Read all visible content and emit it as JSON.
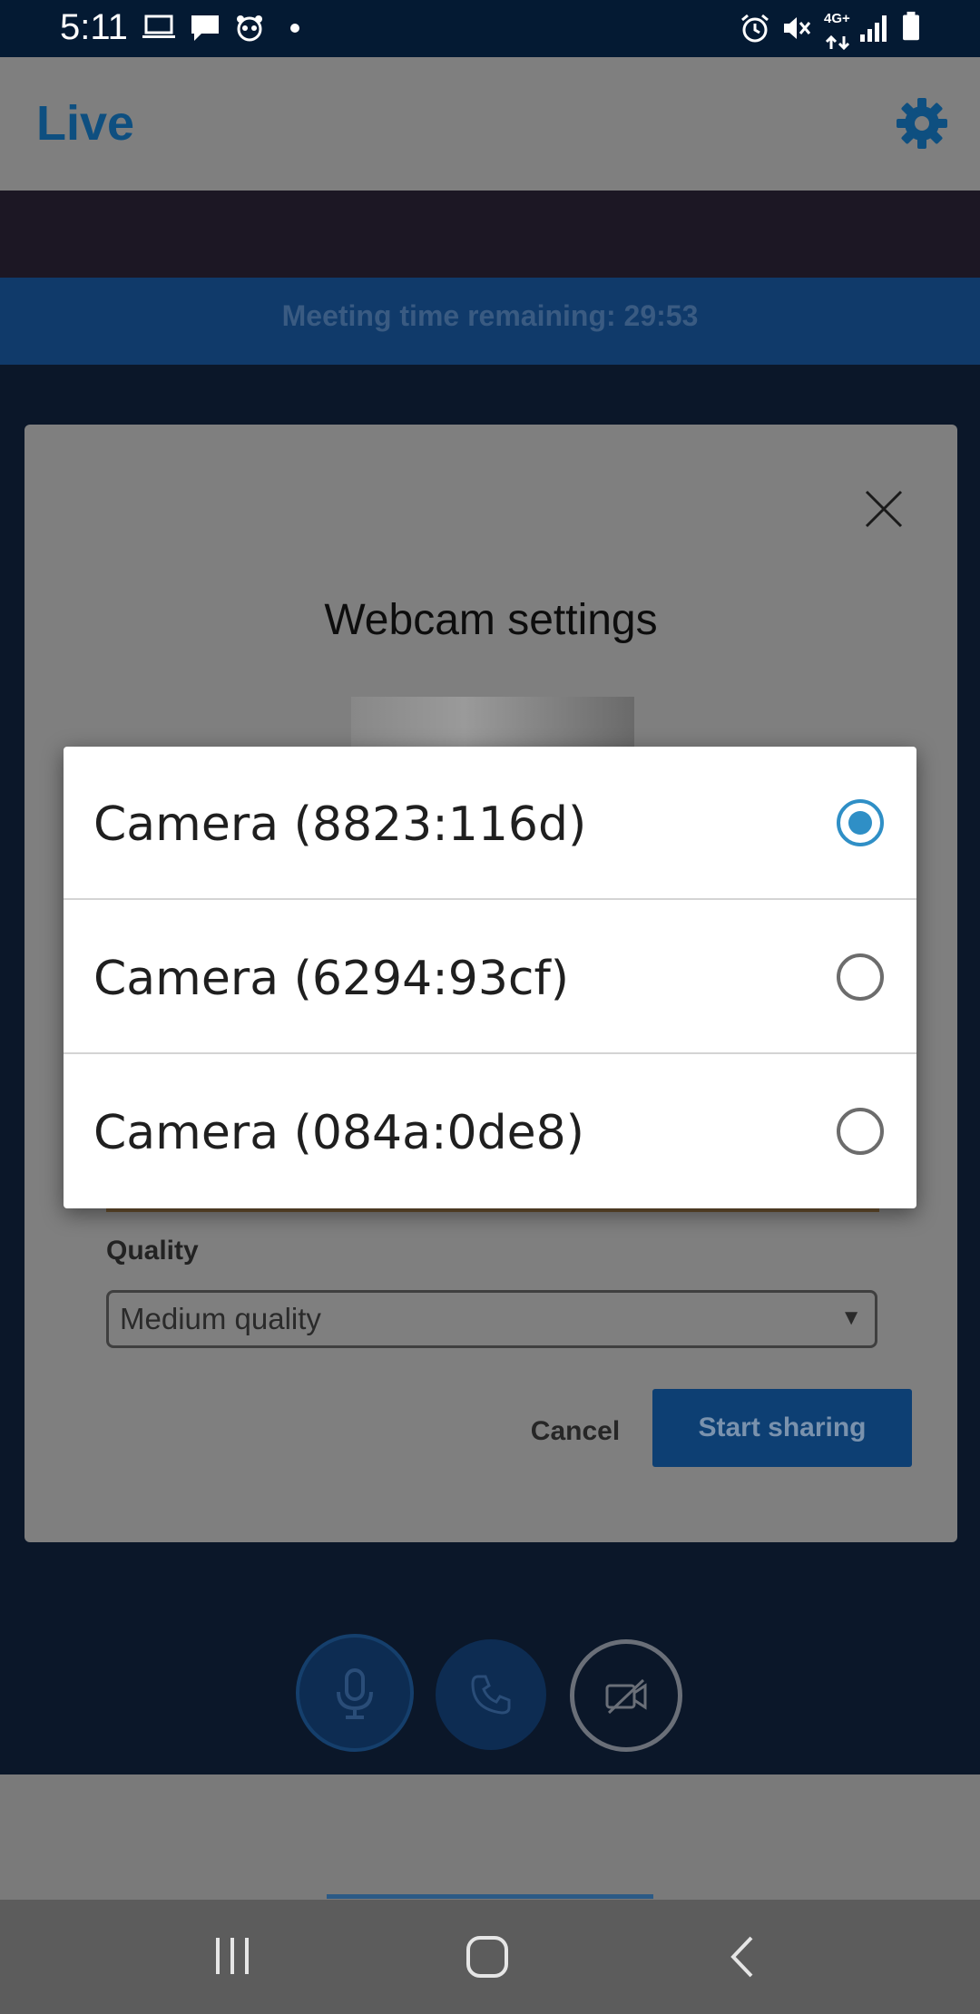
{
  "status_bar": {
    "time": "5:11",
    "network_label": "4G+"
  },
  "app": {
    "title": "Live",
    "meeting_timer": "Meeting time remaining: 29:53"
  },
  "webcam_dialog": {
    "title": "Webcam settings",
    "quality_label": "Quality",
    "quality_value": "Medium quality",
    "quality_arrow": "▼",
    "cancel_label": "Cancel",
    "start_label": "Start sharing"
  },
  "camera_options": [
    {
      "label": "Camera (8823:116d)",
      "selected": true
    },
    {
      "label": "Camera (6294:93cf)",
      "selected": false
    },
    {
      "label": "Camera (084a:0de8)",
      "selected": false
    }
  ],
  "colors": {
    "accent": "#2f8fc6",
    "brand": "#0e4f80",
    "status_bar": "#041a33"
  },
  "icons": {
    "gear": "gear-icon",
    "close": "close-icon",
    "mic": "microphone-icon",
    "phone": "phone-icon",
    "camera_off": "camera-off-icon",
    "nav_recent": "recent-apps-icon",
    "nav_home": "home-icon",
    "nav_back": "back-icon"
  }
}
